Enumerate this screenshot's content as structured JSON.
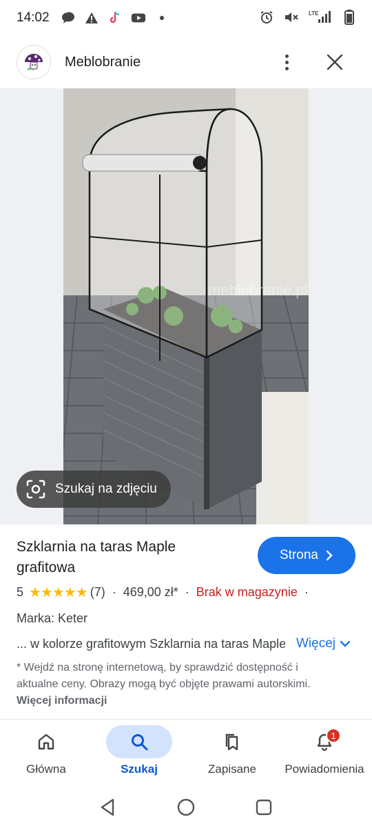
{
  "status_bar": {
    "time": "14:02",
    "left_icons": [
      "chat-bubble-icon",
      "warning-icon",
      "tiktok-icon",
      "youtube-icon",
      "dot-icon"
    ],
    "right_icons": [
      "alarm-icon",
      "mute-icon",
      "signal-icon",
      "battery-icon"
    ],
    "network_label": "LTE"
  },
  "header": {
    "site_name": "Meblobranie"
  },
  "image": {
    "watermark": "meblobranie.pl",
    "lens_label": "Szukaj na zdjęciu"
  },
  "product": {
    "title": "Szklarnia na taras Maple grafitowa",
    "visit_label": "Strona",
    "rating": "5",
    "stars_filled": 5,
    "review_count": "(7)",
    "separator": "·",
    "price": "469,00 zł*",
    "stock_status": "Brak w magazynie",
    "brand": "Marka: Keter",
    "snippet": "... w kolorze grafitowym Szklarnia na taras Maple",
    "more_label": "Więcej",
    "disclaimer": "* Wejdź na stronę internetową, by sprawdzić dostępność i aktualne ceny. Obrazy mogą być objęte prawami autorskimi.",
    "disclaimer_link": "Więcej informacji"
  },
  "bottom_nav": {
    "items": [
      {
        "label": "Główna",
        "icon": "home-icon"
      },
      {
        "label": "Szukaj",
        "icon": "search-icon"
      },
      {
        "label": "Zapisane",
        "icon": "bookmarks-icon"
      },
      {
        "label": "Powiadomienia",
        "icon": "bell-icon"
      }
    ],
    "active": "Szukaj",
    "notification_badge": "1"
  },
  "colors": {
    "accent": "#1a73e8",
    "active_pill": "#d3e3fd",
    "stock_red": "#c5221f",
    "star": "#fbbc04",
    "badge": "#d93025"
  }
}
